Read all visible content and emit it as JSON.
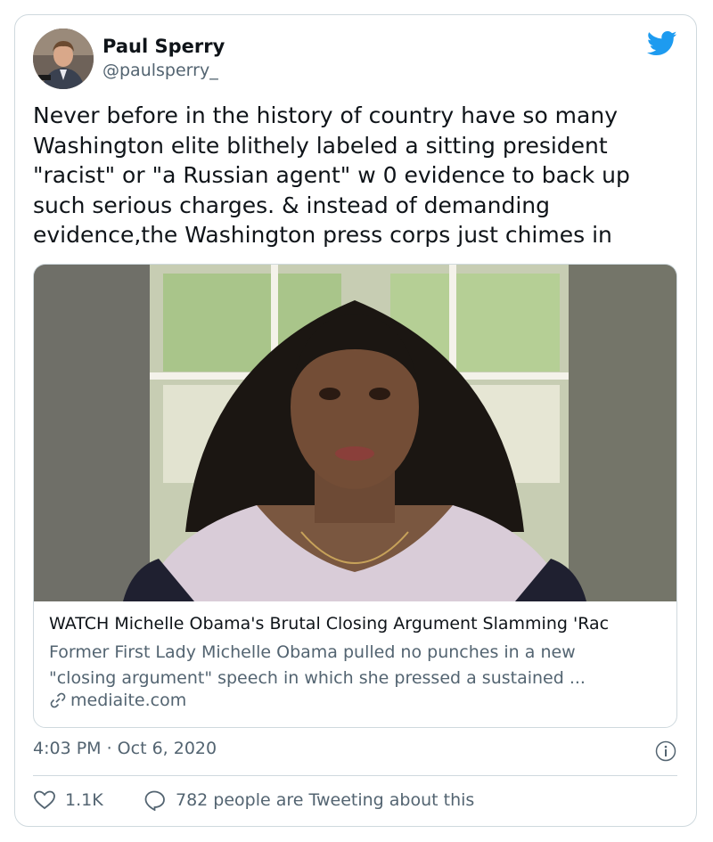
{
  "author": {
    "name": "Paul Sperry",
    "handle": "@paulsperry_"
  },
  "tweet": {
    "text": "Never before in the history of country have so many\nWashington elite blithely labeled a sitting president\n\"racist\" or \"a Russian agent\" w 0 evidence to back up\nsuch serious charges. & instead of demanding\nevidence,the Washington press corps just chimes in"
  },
  "link_card": {
    "title": "WATCH Michelle Obama's Brutal Closing Argument Slamming 'Rac",
    "description": "Former First Lady Michelle Obama pulled no punches in a new\n\"closing argument\" speech in which she pressed a sustained ...",
    "domain": "mediaite.com"
  },
  "meta": {
    "timestamp": "4:03 PM · Oct 6, 2020"
  },
  "actions": {
    "likes": "1.1K",
    "conversation": "782 people are Tweeting about this"
  },
  "colors": {
    "twitter_blue": "#1d9bf0",
    "secondary_text": "#536471",
    "border": "#cfd9de"
  },
  "icons": [
    "twitter-bird-icon",
    "link-icon",
    "info-icon",
    "heart-icon",
    "speech-bubble-icon"
  ]
}
